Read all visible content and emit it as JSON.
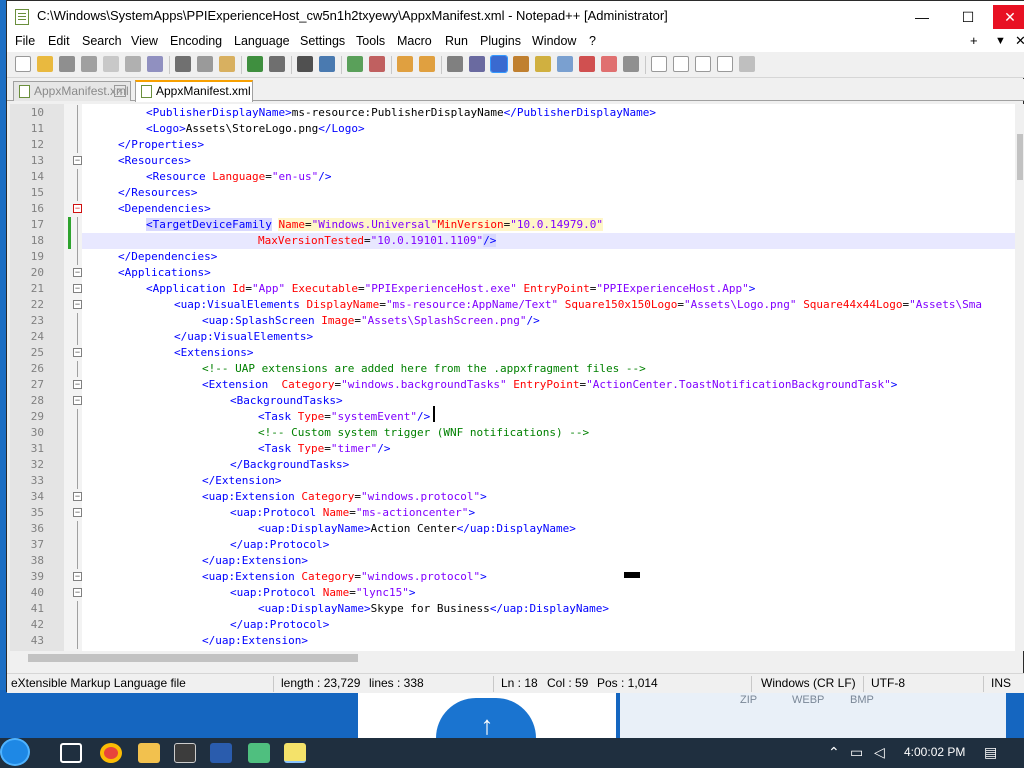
{
  "window": {
    "title": "C:\\Windows\\SystemApps\\PPIExperienceHost_cw5n1h2txyewy\\AppxManifest.xml - Notepad++ [Administrator]",
    "minimize": "—",
    "maximize": "☐",
    "close": "✕"
  },
  "menu": {
    "items": [
      "File",
      "Edit",
      "Search",
      "View",
      "Encoding",
      "Language",
      "Settings",
      "Tools",
      "Macro",
      "Run",
      "Plugins",
      "Window",
      "?"
    ],
    "plus": "+",
    "down": "▼",
    "close": "✕"
  },
  "tabs": [
    {
      "label": "AppxManifest.xml",
      "active": false
    },
    {
      "label": "AppxManifest.xml",
      "active": true
    }
  ],
  "tab_close": "✕",
  "editor": {
    "lines": [
      {
        "n": "10",
        "html": "<span class='t'>&lt;PublisherDisplayName&gt;</span><span class='x'>ms-resource:PublisherDisplayName</span><span class='t'>&lt;/PublisherDisplayName&gt;</span>",
        "indent": 2
      },
      {
        "n": "11",
        "html": "<span class='t'>&lt;Logo&gt;</span><span class='x'>Assets\\StoreLogo.png</span><span class='t'>&lt;/Logo&gt;</span>",
        "indent": 2
      },
      {
        "n": "12",
        "html": "<span class='t'>&lt;/Properties&gt;</span>",
        "indent": 1
      },
      {
        "n": "13",
        "html": "<span class='t'>&lt;Resources&gt;</span>",
        "indent": 1
      },
      {
        "n": "14",
        "html": "<span class='t'>&lt;Resource </span><span class='a'>Language</span><span class='x'>=</span><span class='v'>\"en-us\"</span><span class='t'>/&gt;</span>",
        "indent": 2
      },
      {
        "n": "15",
        "html": "<span class='t'>&lt;/Resources&gt;</span>",
        "indent": 1
      },
      {
        "n": "16",
        "html": "<span class='t'>&lt;Dependencies&gt;</span>",
        "indent": 1
      },
      {
        "n": "17",
        "html": "<span class='t hl'>&lt;TargetDeviceFamily</span> <span class='a hly'>Name</span><span class='x hly'>=</span><span class='v hly'>\"Windows.Universal\"</span><span class='a hly'>MinVersion</span><span class='x hly'>=</span><span class='v hly'>\"10.0.14979.0\"</span>",
        "indent": 2
      },
      {
        "n": "18",
        "html": "<span class='a'>MaxVersionTested</span><span class='x'>=</span><span class='v'>\"10.0.19101.1109\"</span><span class='t hl'>/&gt;</span>",
        "indent": 6
      },
      {
        "n": "19",
        "html": "<span class='t'>&lt;/Dependencies&gt;</span>",
        "indent": 1
      },
      {
        "n": "20",
        "html": "<span class='t'>&lt;Applications&gt;</span>",
        "indent": 1
      },
      {
        "n": "21",
        "html": "<span class='t'>&lt;Application </span><span class='a'>Id</span><span class='x'>=</span><span class='v'>\"App\"</span> <span class='a'>Executable</span><span class='x'>=</span><span class='v'>\"PPIExperienceHost.exe\"</span> <span class='a'>EntryPoint</span><span class='x'>=</span><span class='v'>\"PPIExperienceHost.App\"</span><span class='t'>&gt;</span>",
        "indent": 2
      },
      {
        "n": "22",
        "html": "<span class='t'>&lt;uap:VisualElements </span><span class='a'>DisplayName</span><span class='x'>=</span><span class='v'>\"ms-resource:AppName/Text\"</span> <span class='a'>Square150x150Logo</span><span class='x'>=</span><span class='v'>\"Assets\\Logo.png\"</span> <span class='a'>Square44x44Logo</span><span class='x'>=</span><span class='v'>\"Assets\\Sma</span>",
        "indent": 3
      },
      {
        "n": "23",
        "html": "<span class='t'>&lt;uap:SplashScreen </span><span class='a'>Image</span><span class='x'>=</span><span class='v'>\"Assets\\SplashScreen.png\"</span><span class='t'>/&gt;</span>",
        "indent": 4
      },
      {
        "n": "24",
        "html": "<span class='t'>&lt;/uap:VisualElements&gt;</span>",
        "indent": 3
      },
      {
        "n": "25",
        "html": "<span class='t'>&lt;Extensions&gt;</span>",
        "indent": 3
      },
      {
        "n": "26",
        "html": "<span class='c'>&lt;!-- UAP extensions are added here from the .appxfragment files --&gt;</span>",
        "indent": 4
      },
      {
        "n": "27",
        "html": "<span class='t'>&lt;Extension  </span><span class='a'>Category</span><span class='x'>=</span><span class='v'>\"windows.backgroundTasks\"</span> <span class='a'>EntryPoint</span><span class='x'>=</span><span class='v'>\"ActionCenter.ToastNotificationBackgroundTask\"</span><span class='t'>&gt;</span>",
        "indent": 4
      },
      {
        "n": "28",
        "html": "<span class='t'>&lt;BackgroundTasks&gt;</span>",
        "indent": 5
      },
      {
        "n": "29",
        "html": "<span class='t'>&lt;Task </span><span class='a'>Type</span><span class='x'>=</span><span class='v'>\"systemEvent\"</span><span class='t'>/&gt;</span>",
        "indent": 6
      },
      {
        "n": "30",
        "html": "<span class='c'>&lt;!-- Custom system trigger (WNF notifications) --&gt;</span>",
        "indent": 6
      },
      {
        "n": "31",
        "html": "<span class='t'>&lt;Task </span><span class='a'>Type</span><span class='x'>=</span><span class='v'>\"timer\"</span><span class='t'>/&gt;</span>",
        "indent": 6
      },
      {
        "n": "32",
        "html": "<span class='t'>&lt;/BackgroundTasks&gt;</span>",
        "indent": 5
      },
      {
        "n": "33",
        "html": "<span class='t'>&lt;/Extension&gt;</span>",
        "indent": 4
      },
      {
        "n": "34",
        "html": "<span class='t'>&lt;uap:Extension </span><span class='a'>Category</span><span class='x'>=</span><span class='v'>\"windows.protocol\"</span><span class='t'>&gt;</span>",
        "indent": 4
      },
      {
        "n": "35",
        "html": "<span class='t'>&lt;uap:Protocol </span><span class='a'>Name</span><span class='x'>=</span><span class='v'>\"ms-actioncenter\"</span><span class='t'>&gt;</span>",
        "indent": 5
      },
      {
        "n": "36",
        "html": "<span class='t'>&lt;uap:DisplayName&gt;</span><span class='x'>Action Center</span><span class='t'>&lt;/uap:DisplayName&gt;</span>",
        "indent": 6
      },
      {
        "n": "37",
        "html": "<span class='t'>&lt;/uap:Protocol&gt;</span>",
        "indent": 5
      },
      {
        "n": "38",
        "html": "<span class='t'>&lt;/uap:Extension&gt;</span>",
        "indent": 4
      },
      {
        "n": "39",
        "html": "<span class='t'>&lt;uap:Extension </span><span class='a'>Category</span><span class='x'>=</span><span class='v'>\"windows.protocol\"</span><span class='t'>&gt;</span>",
        "indent": 4
      },
      {
        "n": "40",
        "html": "<span class='t'>&lt;uap:Protocol </span><span class='a'>Name</span><span class='x'>=</span><span class='v'>\"lync15\"</span><span class='t'>&gt;</span>",
        "indent": 5
      },
      {
        "n": "41",
        "html": "<span class='t'>&lt;uap:DisplayName&gt;</span><span class='x'>Skype for Business</span><span class='t'>&lt;/uap:DisplayName&gt;</span>",
        "indent": 6
      },
      {
        "n": "42",
        "html": "<span class='t'>&lt;/uap:Protocol&gt;</span>",
        "indent": 5
      },
      {
        "n": "43",
        "html": "<span class='t'>&lt;/uap:Extension&gt;</span>",
        "indent": 4
      }
    ],
    "fold_boxes": {
      "13": "minus",
      "16": "minus-red",
      "20": "minus",
      "21": "minus",
      "22": "minus",
      "25": "minus",
      "27": "minus",
      "28": "minus",
      "34": "minus",
      "35": "minus",
      "39": "minus",
      "40": "minus"
    },
    "current_line": "18",
    "changed_lines": [
      "17",
      "18"
    ]
  },
  "status": {
    "filetype": "eXtensible Markup Language file",
    "length": "length : 23,729",
    "lines": "lines : 338",
    "ln": "Ln : 18",
    "col": "Col : 59",
    "pos": "Pos : 1,014",
    "eol": "Windows (CR LF)",
    "encoding": "UTF-8",
    "mode": "INS"
  },
  "desktop": {
    "labels": [
      "ZIP",
      "WEBP",
      "BMP"
    ]
  },
  "taskbar": {
    "time": "4:00:02 PM"
  },
  "colors": {
    "tag": "#0000ff",
    "attribute": "#ff0000",
    "value": "#8000ff",
    "comment": "#008000",
    "tab_accent": "#f7a000"
  }
}
